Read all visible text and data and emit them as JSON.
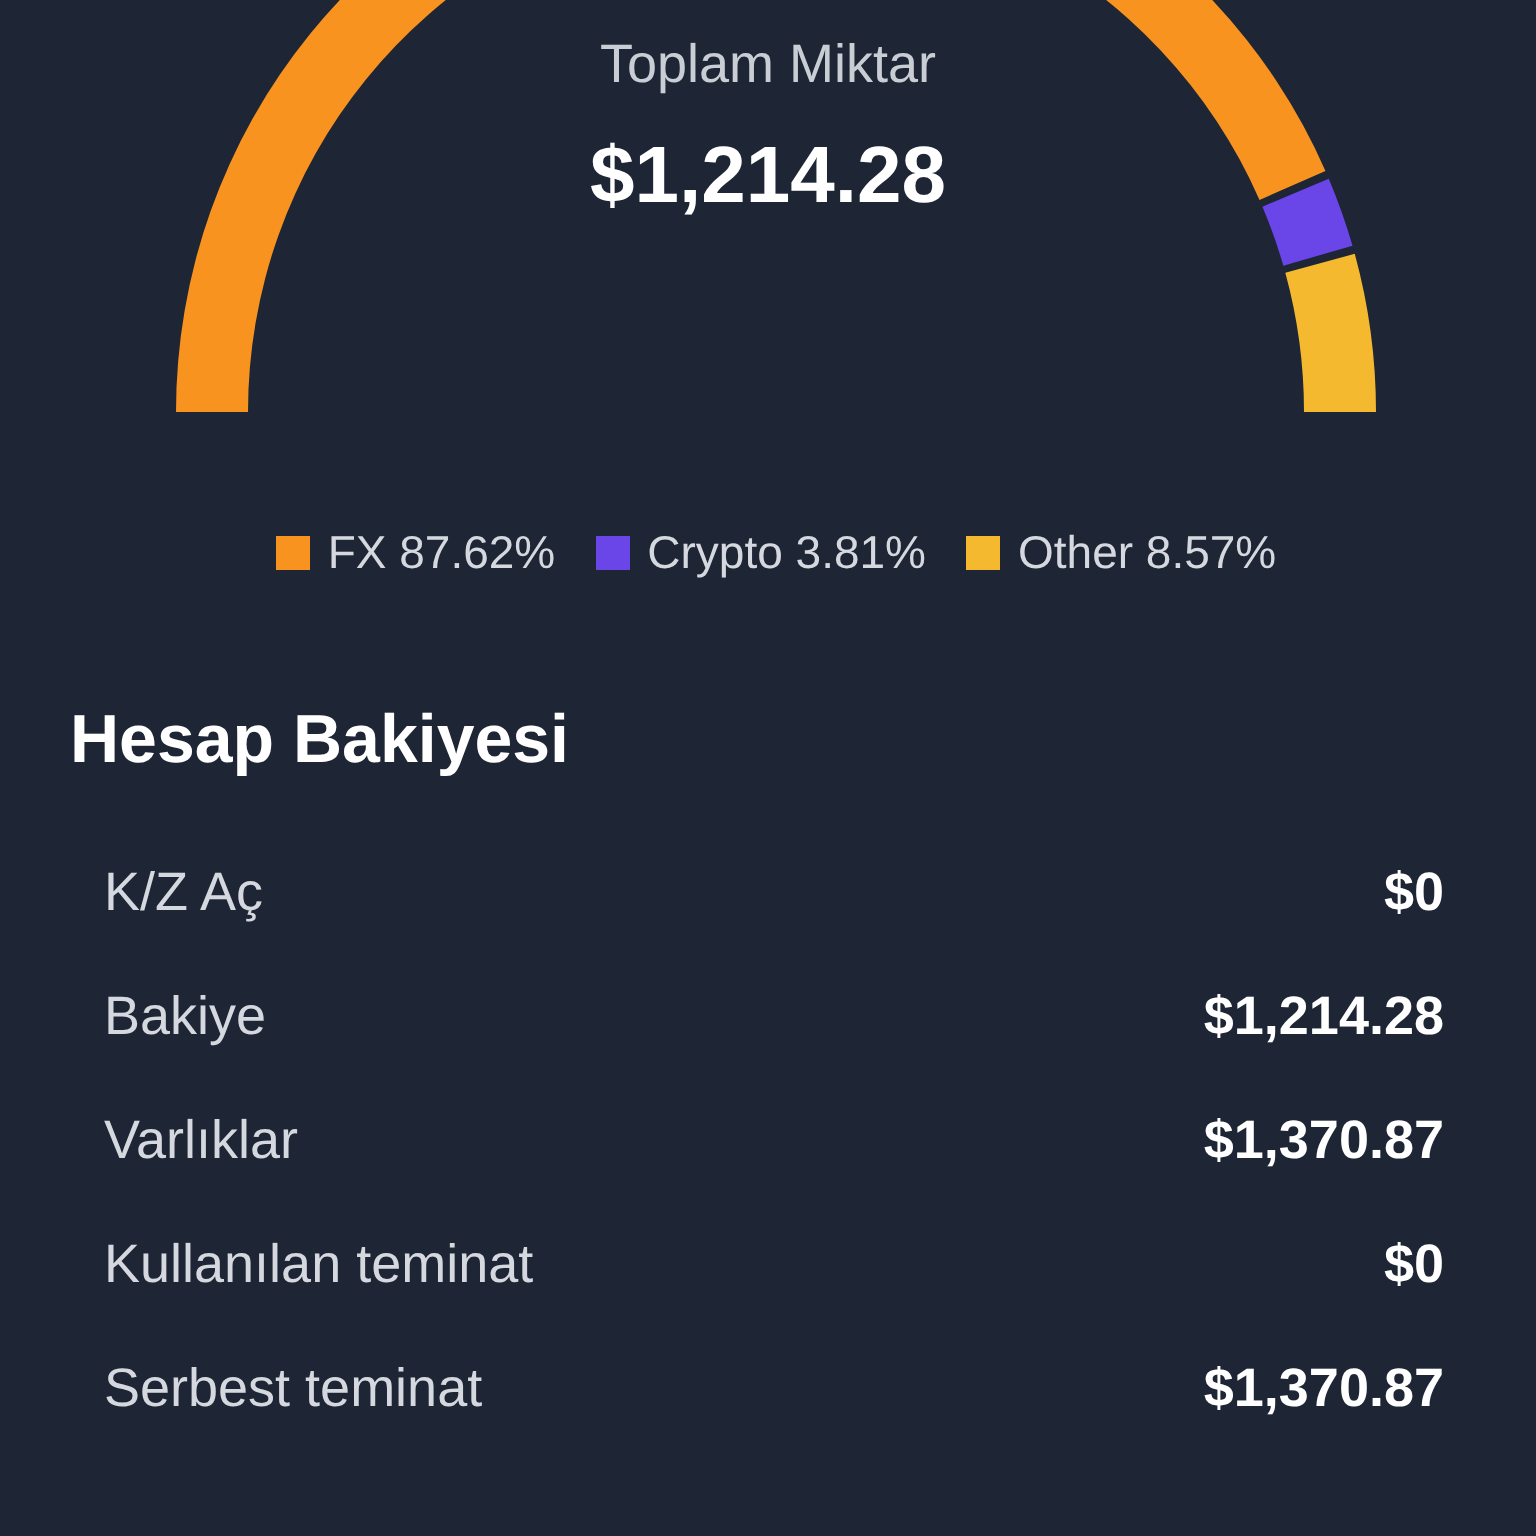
{
  "summary": {
    "title": "Toplam Miktar",
    "amount": "$1,214.28",
    "chart_data": {
      "type": "donut",
      "categories": [
        "FX",
        "Crypto",
        "Other"
      ],
      "values": [
        87.62,
        3.81,
        8.57
      ]
    }
  },
  "legend": [
    {
      "percent": "87.62%",
      "color": "#f7931e"
    },
    {
      "percent": "3.81%",
      "color": "#6a45e8"
    },
    {
      "percent": "8.57%",
      "color": "#f4b92f"
    }
  ],
  "balance": {
    "title": "Hesap Bakiyesi",
    "rows": [
      {
        "label": "K/Z Aç",
        "value": "$0"
      },
      {
        "label": "Bakiye",
        "value": "$1,214.28"
      },
      {
        "label": "Varlıklar",
        "value": "$1,370.87"
      },
      {
        "label": "Kullanılan teminat",
        "value": "$0"
      },
      {
        "label": "Serbest teminat",
        "value": "$1,370.87"
      }
    ]
  }
}
